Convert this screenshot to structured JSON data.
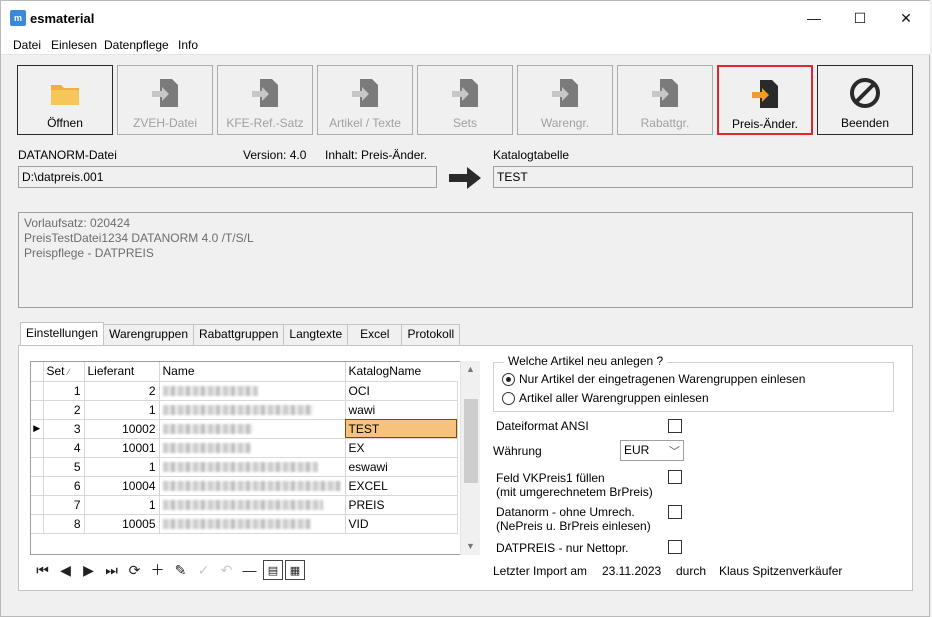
{
  "window": {
    "title": "esmaterial",
    "minimize": "—",
    "maximize": "☐",
    "close": "✕"
  },
  "menu": [
    "Datei",
    "Einlesen",
    "Datenpflege",
    "Info"
  ],
  "toolbar": [
    {
      "label": "Öffnen",
      "icon": "folder-icon",
      "state": "enabled"
    },
    {
      "label": "ZVEH-Datei",
      "icon": "file-import-icon",
      "state": "disabled"
    },
    {
      "label": "KFE-Ref.-Satz",
      "icon": "file-import-icon",
      "state": "disabled"
    },
    {
      "label": "Artikel / Texte",
      "icon": "file-import-icon",
      "state": "disabled"
    },
    {
      "label": "Sets",
      "icon": "file-import-icon",
      "state": "disabled"
    },
    {
      "label": "Warengr.",
      "icon": "file-import-icon",
      "state": "disabled"
    },
    {
      "label": "Rabattgr.",
      "icon": "file-import-icon",
      "state": "disabled"
    },
    {
      "label": "Preis-Änder.",
      "icon": "file-import-icon",
      "state": "active"
    },
    {
      "label": "Beenden",
      "icon": "stop-icon",
      "state": "enabled"
    }
  ],
  "source": {
    "label": "DATANORM-Datei",
    "version": "Version: 4.0",
    "content": "Inhalt: Preis-Änder.",
    "path": "D:\\datpreis.001"
  },
  "target": {
    "label": "Katalogtabelle",
    "value": "TEST"
  },
  "info_lines": [
    "Vorlaufsatz: 020424",
    "PreisTestDatei1234 DATANORM 4.0 /T/S/L",
    "Preispflege - DATPREIS"
  ],
  "tabs": [
    "Einstellungen",
    "Warengruppen",
    "Rabattgruppen",
    "Langtexte",
    "Excel",
    "Protokoll"
  ],
  "active_tab": "Einstellungen",
  "grid": {
    "columns": [
      "Set",
      "Lieferant",
      "Name",
      "KatalogName"
    ],
    "sort_indicator": "∕",
    "rows": [
      {
        "set": "1",
        "lieferant": "2",
        "katalog": "OCI"
      },
      {
        "set": "2",
        "lieferant": "1",
        "katalog": "wawi"
      },
      {
        "set": "3",
        "lieferant": "10002",
        "katalog": "TEST",
        "selected": true
      },
      {
        "set": "4",
        "lieferant": "10001",
        "katalog": "EX"
      },
      {
        "set": "5",
        "lieferant": "1",
        "katalog": "eswawi"
      },
      {
        "set": "6",
        "lieferant": "10004",
        "katalog": "EXCEL"
      },
      {
        "set": "7",
        "lieferant": "1",
        "katalog": "PREIS"
      },
      {
        "set": "8",
        "lieferant": "10005",
        "katalog": "VID"
      }
    ]
  },
  "options": {
    "group_title": "Welche Artikel neu anlegen ?",
    "radio_1": "Nur Artikel der eingetragenen Warengruppen einlesen",
    "radio_2": "Artikel aller Warengruppen einlesen",
    "ansi": "Dateiformat ANSI",
    "currency_label": "Währung",
    "currency_value": "EUR",
    "vk_line1": "Feld VKPreis1 füllen",
    "vk_line2": "(mit umgerechnetem BrPreis)",
    "dn_line1": "Datanorm - ohne Umrech.",
    "dn_line2": "(NePreis u. BrPreis einlesen)",
    "netto": "DATPREIS - nur Nettopr.",
    "last_import_label": "Letzter Import am",
    "last_import_date": "23.11.2023",
    "by": "durch",
    "user": "Klaus Spitzenverkäufer"
  }
}
